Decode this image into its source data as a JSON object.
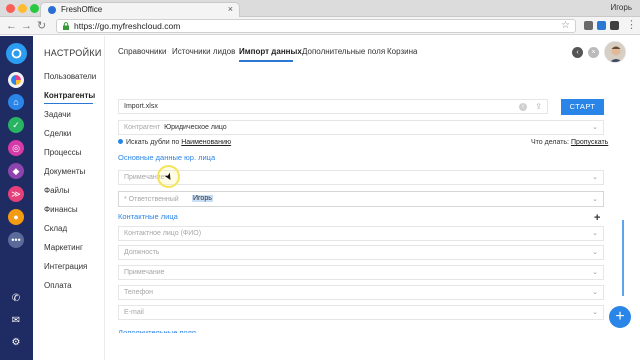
{
  "window": {
    "tab_title": "FreshOffice",
    "user": "Игорь"
  },
  "browser": {
    "url": "https://go.myfreshcloud.com"
  },
  "sidebar_menu": {
    "title": "НАСТРОЙКИ",
    "items": [
      "Пользователи",
      "Контрагенты",
      "Задачи",
      "Сделки",
      "Процессы",
      "Документы",
      "Файлы",
      "Финансы",
      "Склад",
      "Маркетинг",
      "Интеграция",
      "Оплата"
    ],
    "active": "Контрагенты"
  },
  "tabs": {
    "items": [
      "Справочники",
      "Источники лидов",
      "Импорт данных",
      "Дополнительные поля",
      "Корзина"
    ],
    "active": "Импорт данных"
  },
  "import": {
    "file_name": "Import.xlsx",
    "start_button": "СТАРТ",
    "contractor_label": "Контрагент",
    "contractor_value": "Юридическое лицо",
    "dup_prefix": "Искать дубли по",
    "dup_link": "Наименованию",
    "action_prefix": "Что делать:",
    "action_link": "Пропускать"
  },
  "sections": {
    "main_data": "Основные данные юр. лица",
    "contacts": "Контактные лица",
    "extra": "Дополнительные поля"
  },
  "fields": {
    "note": "Примечание",
    "responsible_label": "* Ответственный",
    "responsible_value": "Игорь",
    "contact_name": "Контактное лицо (ФИО)",
    "position": "Должность",
    "contact_note": "Примечание",
    "phone": "Телефон",
    "email": "E-mail"
  },
  "icons": {
    "rail": [
      "freshoffice-logo-icon",
      "pie-chart-icon",
      "home-icon",
      "check-icon",
      "target-icon",
      "shield-icon",
      "fish-icon",
      "coin-icon",
      "more-icon",
      "phone-icon",
      "mail-icon",
      "gear-icon"
    ]
  },
  "colors": {
    "accent": "#2a85e8",
    "rail": "#1f2b63"
  }
}
